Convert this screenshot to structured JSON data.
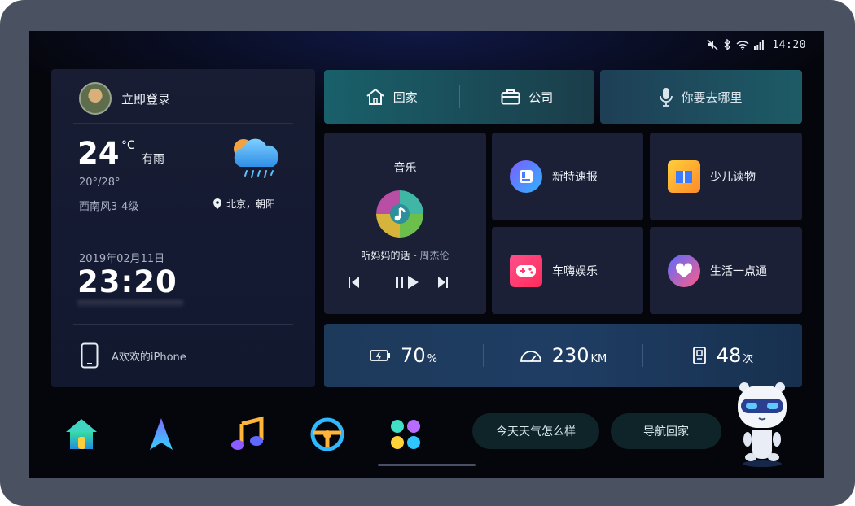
{
  "status_bar": {
    "time": "14:20",
    "icons": [
      "mute-icon",
      "bluetooth-icon",
      "wifi-icon",
      "signal-icon"
    ]
  },
  "profile": {
    "login_label": "立即登录"
  },
  "weather": {
    "temperature": "24",
    "degree_unit": "°C",
    "condition": "有雨",
    "range": "20°/28°",
    "wind": "西南风3-4级",
    "location": "北京，朝阳",
    "icon": "cloud-rain-sun-icon"
  },
  "datetime": {
    "date": "2019年02月11日",
    "time": "23:20"
  },
  "device": {
    "name": "A欢欢的iPhone"
  },
  "navigation": {
    "home_label": "回家",
    "company_label": "公司",
    "voice_prompt": "你要去哪里"
  },
  "music": {
    "title": "音乐",
    "song": "听妈妈的话",
    "separator": " - ",
    "artist": "周杰伦"
  },
  "apps": [
    {
      "label": "新特速报",
      "icon": "news-icon"
    },
    {
      "label": "少儿读物",
      "icon": "book-icon"
    },
    {
      "label": "车嗨娱乐",
      "icon": "gamepad-icon"
    },
    {
      "label": "生活一点通",
      "icon": "heart-icon"
    }
  ],
  "stats": {
    "battery": {
      "value": "70",
      "unit": "%"
    },
    "range": {
      "value": "230",
      "unit": "KM"
    },
    "charges": {
      "value": "48",
      "unit": "次"
    }
  },
  "dock": [
    "home-icon",
    "navigation-icon",
    "music-icon",
    "steering-wheel-icon",
    "apps-grid-icon"
  ],
  "suggestions": {
    "weather_query": "今天天气怎么样",
    "navigate_home": "导航回家"
  },
  "colors": {
    "accent_teal": "#1a5e68",
    "tile_bg": "#1b2036",
    "screen_bg": "#05060c"
  }
}
